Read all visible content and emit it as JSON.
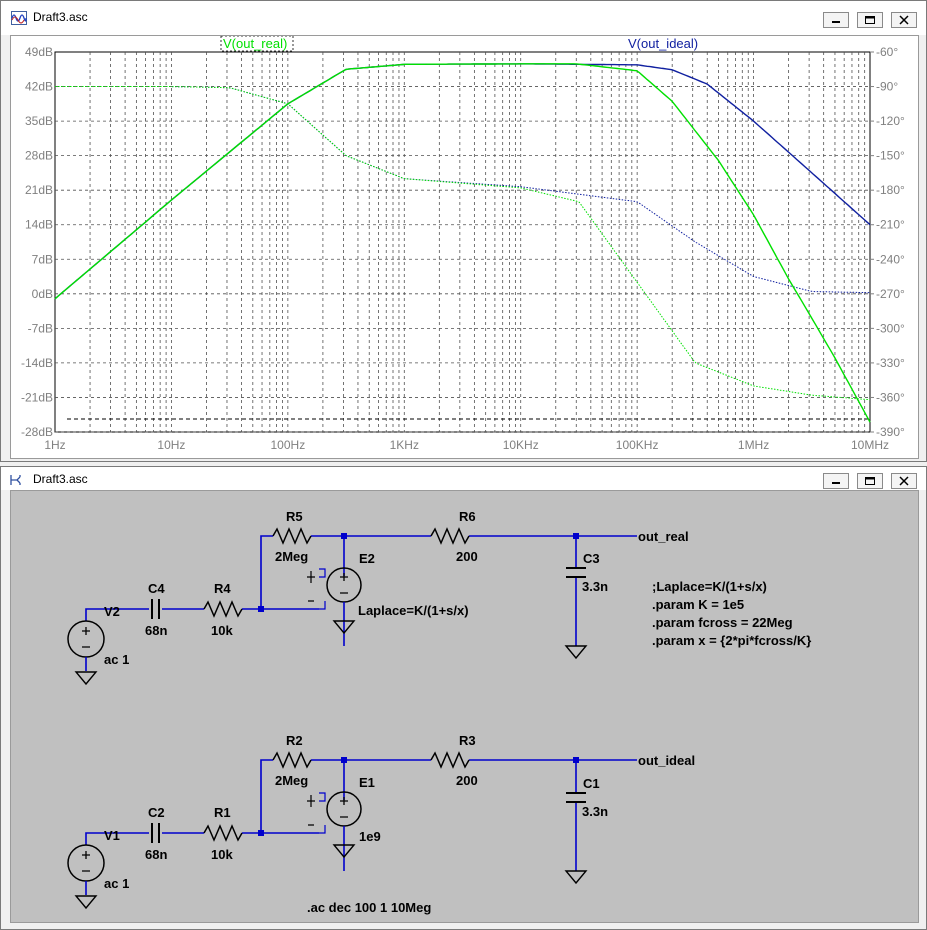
{
  "plot_window": {
    "title": "Draft3.asc",
    "icon": "waveform-icon",
    "buttons": [
      "minimize-icon",
      "maximize-icon",
      "close-icon"
    ]
  },
  "schematic_window": {
    "title": "Draft3.asc",
    "icon": "schematic-icon",
    "buttons": [
      "minimize-icon",
      "maximize-icon",
      "close-icon"
    ]
  },
  "chart_data": {
    "type": "line",
    "x_scale": "log",
    "xlim": [
      1,
      10000000
    ],
    "x_tick_labels": [
      "1Hz",
      "10Hz",
      "100Hz",
      "1KHz",
      "10KHz",
      "100KHz",
      "1MHz",
      "10MHz"
    ],
    "ylim_left": [
      -28,
      49
    ],
    "y_left_tick_labels": [
      "49dB",
      "42dB",
      "35dB",
      "28dB",
      "21dB",
      "14dB",
      "7dB",
      "0dB",
      "-7dB",
      "-14dB",
      "-21dB",
      "-28dB"
    ],
    "ylim_right": [
      -390,
      -60
    ],
    "y_right_tick_labels": [
      "-60°",
      "-90°",
      "-120°",
      "-150°",
      "-180°",
      "-210°",
      "-240°",
      "-270°",
      "-300°",
      "-330°",
      "-360°",
      "-390°"
    ],
    "grid": true,
    "series": [
      {
        "name": "V(out_real)",
        "color": "#00e000",
        "magnitude_db": [
          [
            1,
            -1
          ],
          [
            10,
            19
          ],
          [
            100,
            38.5
          ],
          [
            316,
            45.5
          ],
          [
            1000,
            46.5
          ],
          [
            10000,
            46.6
          ],
          [
            30000,
            46.6
          ],
          [
            100000,
            45.2
          ],
          [
            200000,
            39
          ],
          [
            500000,
            27
          ],
          [
            1000000,
            16
          ],
          [
            2000000,
            3
          ],
          [
            3000000,
            -4
          ],
          [
            5000000,
            -13
          ],
          [
            10000000,
            -26
          ]
        ],
        "phase_deg": [
          [
            1,
            -90
          ],
          [
            10,
            -90
          ],
          [
            31.6,
            -91
          ],
          [
            100,
            -105
          ],
          [
            316,
            -150
          ],
          [
            1000,
            -170
          ],
          [
            10000,
            -178
          ],
          [
            31600,
            -190
          ],
          [
            100000,
            -260
          ],
          [
            316000,
            -330
          ],
          [
            1000000,
            -350
          ],
          [
            3160000,
            -358
          ],
          [
            10000000,
            -362
          ]
        ]
      },
      {
        "name": "V(out_ideal)",
        "color": "#1020a0",
        "magnitude_db": [
          [
            1,
            -1
          ],
          [
            10,
            19
          ],
          [
            100,
            38.5
          ],
          [
            316,
            45.5
          ],
          [
            1000,
            46.5
          ],
          [
            10000,
            46.6
          ],
          [
            100000,
            46.4
          ],
          [
            200000,
            45.4
          ],
          [
            400000,
            42.5
          ],
          [
            1000000,
            35
          ],
          [
            3000000,
            25
          ],
          [
            10000000,
            14
          ]
        ],
        "phase_deg": [
          [
            1,
            -90
          ],
          [
            10,
            -90
          ],
          [
            31.6,
            -91
          ],
          [
            100,
            -105
          ],
          [
            316,
            -150
          ],
          [
            1000,
            -170
          ],
          [
            10000,
            -177
          ],
          [
            100000,
            -190
          ],
          [
            316000,
            -225
          ],
          [
            1000000,
            -255
          ],
          [
            3160000,
            -268
          ],
          [
            10000000,
            -269
          ]
        ]
      }
    ]
  },
  "schematic": {
    "components": {
      "R5": {
        "name": "R5",
        "value": "2Meg"
      },
      "R6": {
        "name": "R6",
        "value": "200"
      },
      "C3": {
        "name": "C3",
        "value": "3.3n"
      },
      "C4": {
        "name": "C4",
        "value": "68n"
      },
      "R4": {
        "name": "R4",
        "value": "10k"
      },
      "V2": {
        "name": "V2",
        "value": "ac 1"
      },
      "E2": {
        "name": "E2",
        "value": "Laplace=K/(1+s/x)"
      },
      "R2": {
        "name": "R2",
        "value": "2Meg"
      },
      "R3": {
        "name": "R3",
        "value": "200"
      },
      "C1": {
        "name": "C1",
        "value": "3.3n"
      },
      "C2": {
        "name": "C2",
        "value": "68n"
      },
      "R1": {
        "name": "R1",
        "value": "10k"
      },
      "V1": {
        "name": "V1",
        "value": "ac 1"
      },
      "E1": {
        "name": "E1",
        "value": "1e9"
      }
    },
    "net_labels": {
      "out_real": "out_real",
      "out_ideal": "out_ideal"
    },
    "directives": [
      ";Laplace=K/(1+s/x)",
      ".param K = 1e5",
      ".param fcross = 22Meg",
      ".param x = {2*pi*fcross/K}"
    ],
    "analysis": ".ac dec 100 1 10Meg"
  }
}
